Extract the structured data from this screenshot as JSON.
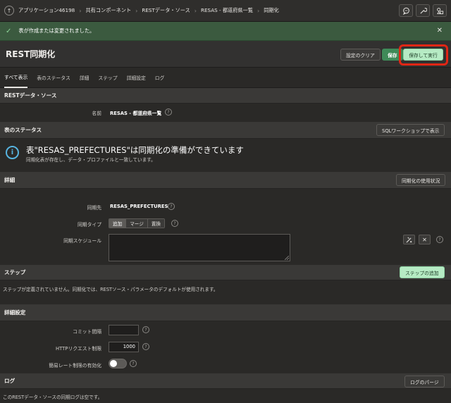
{
  "breadcrumb": {
    "items": [
      "アプリケーション46198",
      "共有コンポーネント",
      "RESTデータ・ソース",
      "RESAS - 都道府県一覧",
      "同期化"
    ]
  },
  "top_icons": [
    "comment-icon",
    "wrench-icon",
    "shapes-icon"
  ],
  "success": {
    "message": "表が作成または変更されました。"
  },
  "header": {
    "title": "REST同期化",
    "clear_label": "設定のクリア",
    "save_label": "保存",
    "save_run_label": "保存して実行"
  },
  "tabs": [
    "すべて表示",
    "表のステータス",
    "詳細",
    "ステップ",
    "詳細設定",
    "ログ"
  ],
  "rest_source": {
    "heading": "RESTデータ・ソース",
    "name_label": "名前",
    "name_value": "RESAS - 都道府県一覧"
  },
  "table_status": {
    "heading": "表のステータス",
    "sql_button": "SQLワークショップで表示",
    "info_title": "表\"RESAS_PREFECTURES\"は同期化の準備ができています",
    "info_sub": "同期化表が存在し、データ・プロファイルと一致しています。"
  },
  "details": {
    "heading": "詳細",
    "usage_button": "同期化の使用状況",
    "target_label": "同期先",
    "target_value": "RESAS_PREFECTURES",
    "type_label": "同期タイプ",
    "type_options": [
      "追加",
      "マージ",
      "置換"
    ],
    "type_selected": "追加",
    "schedule_label": "同期スケジュール"
  },
  "steps": {
    "heading": "ステップ",
    "add_button": "ステップの追加",
    "note": "ステップが定義されていません。同期化では、RESTソース・パラメータのデフォルトが使用されます。"
  },
  "advanced": {
    "heading": "詳細設定",
    "commit_label": "コミット間隔",
    "commit_value": "",
    "http_label": "HTTPリクエスト制限",
    "http_value": "1000",
    "rate_label": "簡易レート制限の有効化",
    "rate_enabled": false
  },
  "log": {
    "heading": "ログ",
    "purge_button": "ログのパージ",
    "note": "このRESTデータ・ソースの同期ログは空です。"
  },
  "colors": {
    "success_bg": "#3b5a3f",
    "primary": "#3f8a58",
    "highlight": "#e02615",
    "info": "#57b4e0"
  }
}
